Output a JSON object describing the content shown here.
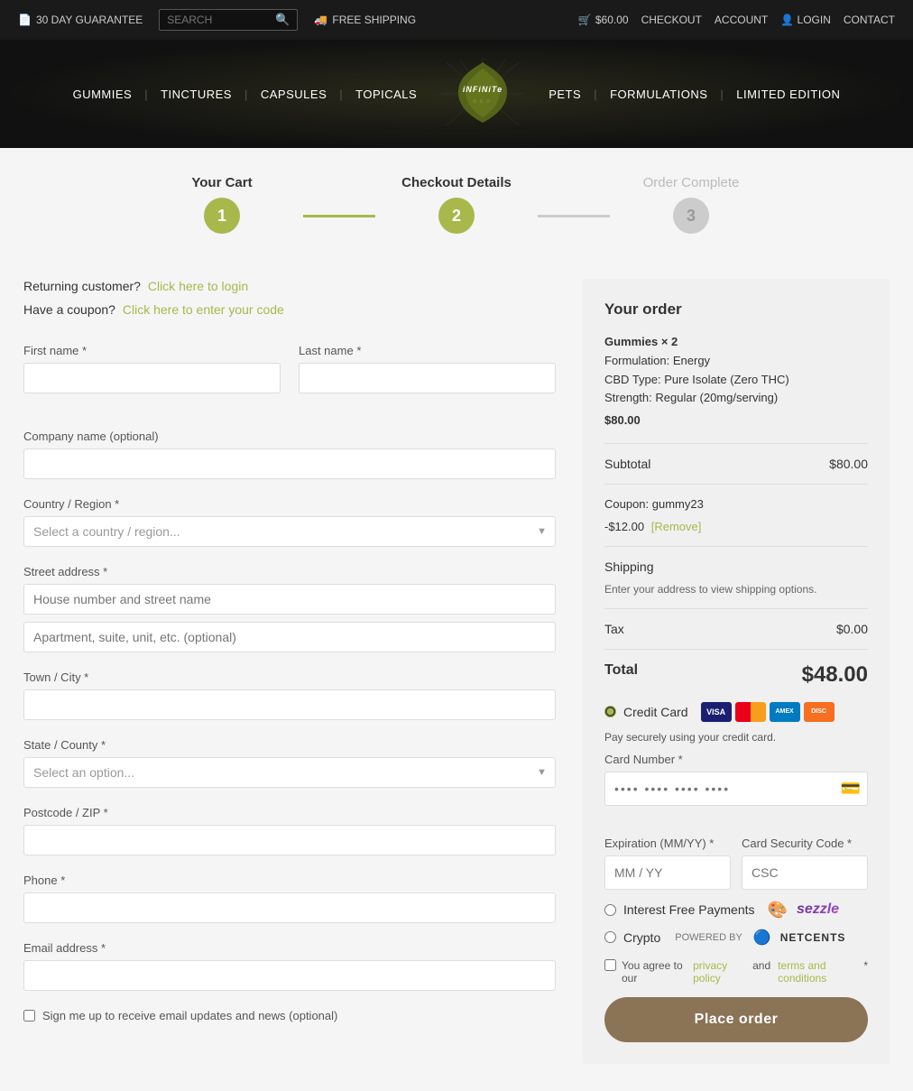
{
  "topbar": {
    "guarantee_label": "30 DAY GUARANTEE",
    "search_placeholder": "SEARCH",
    "free_shipping": "FREE SHIPPING",
    "cart_amount": "$60.00",
    "checkout_link": "CHECKOUT",
    "account_link": "ACCOUNT",
    "login_link": "LOGIN",
    "contact_link": "CONTACT"
  },
  "nav": {
    "brand": "iNFiNiTe",
    "brand_dots": "○○○",
    "items": [
      {
        "label": "GUMMIES",
        "id": "gummies"
      },
      {
        "label": "TINCTURES",
        "id": "tinctures"
      },
      {
        "label": "CAPSULES",
        "id": "capsules"
      },
      {
        "label": "TOPICALS",
        "id": "topicals"
      },
      {
        "label": "PETS",
        "id": "pets"
      },
      {
        "label": "FORMULATIONS",
        "id": "formulations"
      },
      {
        "label": "LIMITED EDITION",
        "id": "limited-edition"
      }
    ]
  },
  "progress": {
    "step1_label": "Your Cart",
    "step2_label": "Checkout Details",
    "step3_label": "Order Complete",
    "step1_num": "1",
    "step2_num": "2",
    "step3_num": "3"
  },
  "form": {
    "returning_text": "Returning customer?",
    "returning_link": "Click here to login",
    "coupon_text": "Have a coupon?",
    "coupon_link": "Click here to enter your code",
    "first_name_label": "First name *",
    "last_name_label": "Last name *",
    "company_label": "Company name (optional)",
    "country_label": "Country / Region *",
    "country_placeholder": "Select a country / region...",
    "street_label": "Street address *",
    "street_placeholder": "House number and street name",
    "apt_placeholder": "Apartment, suite, unit, etc. (optional)",
    "city_label": "Town / City *",
    "state_label": "State / County *",
    "state_placeholder": "Select an option...",
    "postcode_label": "Postcode / ZIP *",
    "phone_label": "Phone *",
    "email_label": "Email address *",
    "signup_label": "Sign me up to receive email updates and news (optional)"
  },
  "order": {
    "title": "Your order",
    "item_name": "Gummies × 2",
    "formulation": "Formulation: Energy",
    "cbd_type": "CBD Type: Pure Isolate (Zero THC)",
    "strength": "Strength: Regular (20mg/serving)",
    "item_price": "$80.00",
    "subtotal_label": "Subtotal",
    "subtotal": "$80.00",
    "coupon_label": "Coupon: gummy23",
    "coupon_discount": "-$12.00",
    "remove_label": "[Remove]",
    "shipping_label": "Shipping",
    "shipping_desc": "Enter your address to view shipping options.",
    "tax_label": "Tax",
    "tax": "$0.00",
    "total_label": "Total",
    "total": "$48.00"
  },
  "payment": {
    "credit_card_label": "Credit Card",
    "pay_desc": "Pay securely using your credit card.",
    "card_number_label": "Card Number *",
    "card_placeholder": "•••• •••• •••• ••••",
    "expiry_label": "Expiration (MM/YY) *",
    "expiry_placeholder": "MM / YY",
    "csc_label": "Card Security Code *",
    "csc_placeholder": "CSC",
    "sezzle_label": "Interest Free Payments",
    "sezzle_brand": "sezzle",
    "crypto_label": "Crypto",
    "powered_by": "POWERED BY",
    "netcents_brand": "netcents",
    "agree_text": "You agree to our",
    "privacy_link": "privacy policy",
    "and_text": "and",
    "terms_link": "terms and conditions",
    "place_order_label": "Place order"
  }
}
